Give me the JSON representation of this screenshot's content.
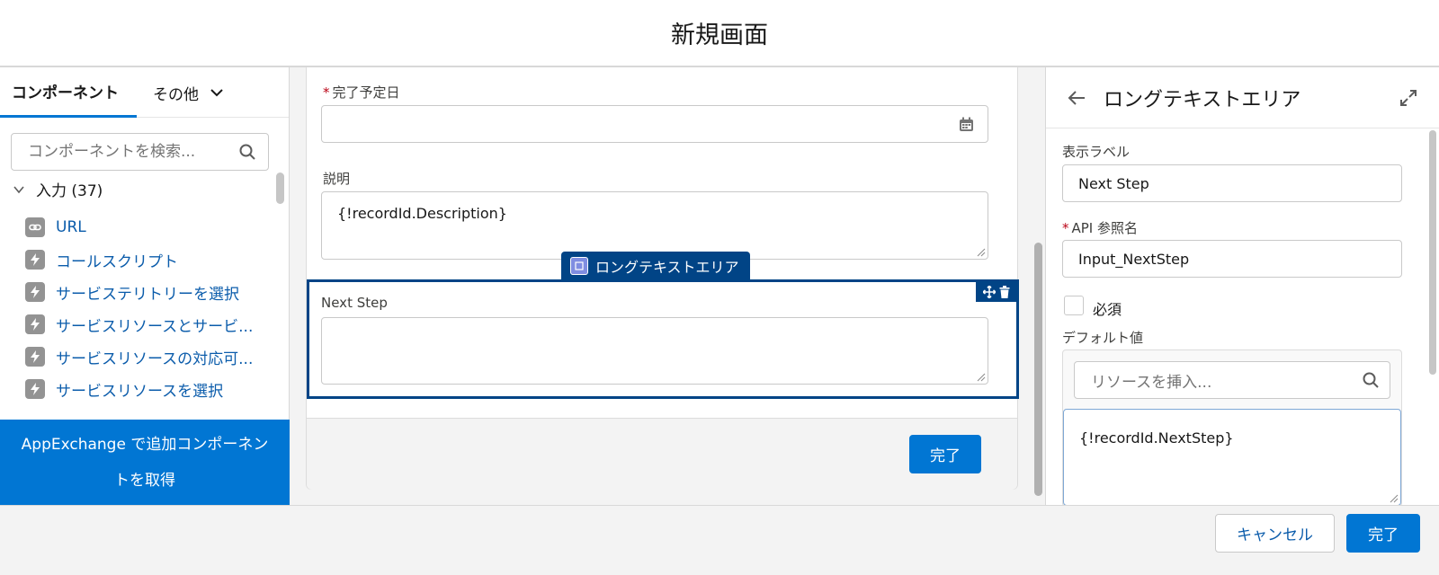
{
  "header": {
    "title": "新規画面"
  },
  "left_panel": {
    "tab_components": "コンポーネント",
    "tab_other": "その他",
    "search_placeholder": "コンポーネントを検索...",
    "section_label": "入力 (37)",
    "items": [
      {
        "label": "URL",
        "icon": "link-icon"
      },
      {
        "label": "コールスクリプト",
        "icon": "lightning-icon"
      },
      {
        "label": "サービステリトリーを選択",
        "icon": "lightning-icon"
      },
      {
        "label": "サービスリソースとサービ...",
        "icon": "lightning-icon"
      },
      {
        "label": "サービスリソースの対応可...",
        "icon": "lightning-icon"
      },
      {
        "label": "サービスリソースを選択",
        "icon": "lightning-icon"
      }
    ],
    "appexchange_label": "AppExchange で追加コンポーネントを取得"
  },
  "canvas": {
    "date_field_label": "完了予定日",
    "description_label": "説明",
    "description_value": "{!recordId.Description}",
    "selected_tag": "ロングテキストエリア",
    "next_step_label": "Next Step",
    "done_button": "完了"
  },
  "properties": {
    "title": "ロングテキストエリア",
    "display_label_label": "表示ラベル",
    "display_label_value": "Next Step",
    "api_name_label": "API 参照名",
    "api_name_value": "Input_NextStep",
    "required_label": "必須",
    "default_value_label": "デフォルト値",
    "resource_placeholder": "リソースを挿入...",
    "default_value": "{!recordId.NextStep}"
  },
  "footer": {
    "cancel_button": "キャンセル",
    "done_button": "完了"
  },
  "colors": {
    "brand": "#0176d3",
    "selection": "#014486",
    "link": "#0b5cab",
    "required": "#ba0517"
  }
}
